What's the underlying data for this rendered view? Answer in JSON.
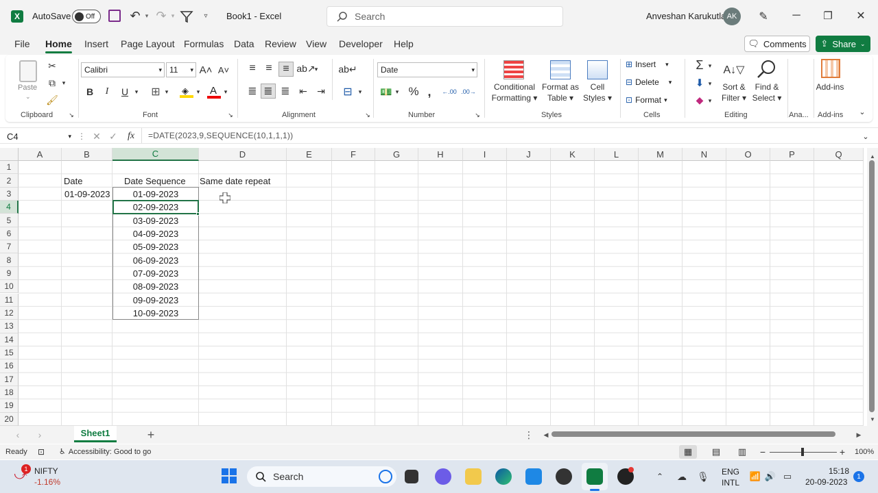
{
  "titlebar": {
    "autosave_label": "AutoSave",
    "autosave_state": "Off",
    "doc_title": "Book1  -  Excel",
    "search_placeholder": "Search",
    "user_name": "Anveshan Karukutla",
    "user_initials": "AK"
  },
  "menu": {
    "tabs": [
      "File",
      "Home",
      "Insert",
      "Page Layout",
      "Formulas",
      "Data",
      "Review",
      "View",
      "Developer",
      "Help"
    ],
    "active": "Home",
    "comments_label": "Comments",
    "share_label": "Share"
  },
  "ribbon": {
    "paste_label": "Paste",
    "font_name": "Calibri",
    "font_size": "11",
    "number_format": "Date",
    "bold": "B",
    "italic": "I",
    "underline": "U",
    "conditional_formatting": [
      "Conditional",
      "Formatting"
    ],
    "format_as_table": [
      "Format as",
      "Table"
    ],
    "cell_styles": [
      "Cell",
      "Styles"
    ],
    "insert": "Insert",
    "delete": "Delete",
    "format": "Format",
    "sort_filter": [
      "Sort &",
      "Filter"
    ],
    "find_select": [
      "Find &",
      "Select"
    ],
    "addins": "Add-ins",
    "groups": {
      "clipboard": "Clipboard",
      "font": "Font",
      "alignment": "Alignment",
      "number": "Number",
      "styles": "Styles",
      "cells": "Cells",
      "editing": "Editing",
      "analysis": "Ana...",
      "addins": "Add-ins"
    }
  },
  "formula_bar": {
    "name_box": "C4",
    "fx": "fx",
    "formula": "=DATE(2023,9,SEQUENCE(10,1,1,1))"
  },
  "sheet": {
    "columns": [
      "A",
      "B",
      "C",
      "D",
      "E",
      "F",
      "G",
      "H",
      "I",
      "J",
      "K",
      "L",
      "M",
      "N",
      "O",
      "P",
      "Q"
    ],
    "rows": [
      "1",
      "2",
      "3",
      "4",
      "5",
      "6",
      "7",
      "8",
      "9",
      "10",
      "11",
      "12",
      "13",
      "14",
      "15",
      "16",
      "17",
      "18",
      "19",
      "20"
    ],
    "b2": "Date",
    "c2": "Date Sequence",
    "d2": "Same date repeat",
    "b3": "01-09-2023",
    "sequence": [
      "01-09-2023",
      "02-09-2023",
      "03-09-2023",
      "04-09-2023",
      "05-09-2023",
      "06-09-2023",
      "07-09-2023",
      "08-09-2023",
      "09-09-2023",
      "10-09-2023"
    ],
    "tab_name": "Sheet1"
  },
  "status": {
    "ready": "Ready",
    "accessibility": "Accessibility: Good to go",
    "zoom": "100%"
  },
  "taskbar": {
    "ticker_name": "NIFTY",
    "ticker_change": "-1.16%",
    "ticker_badge": "1",
    "search_label": "Search",
    "lang1": "ENG",
    "lang2": "INTL",
    "time": "15:18",
    "date": "20-09-2023",
    "notif_count": "1"
  },
  "colors": {
    "excel_green": "#107c41",
    "selection": "#217346"
  }
}
